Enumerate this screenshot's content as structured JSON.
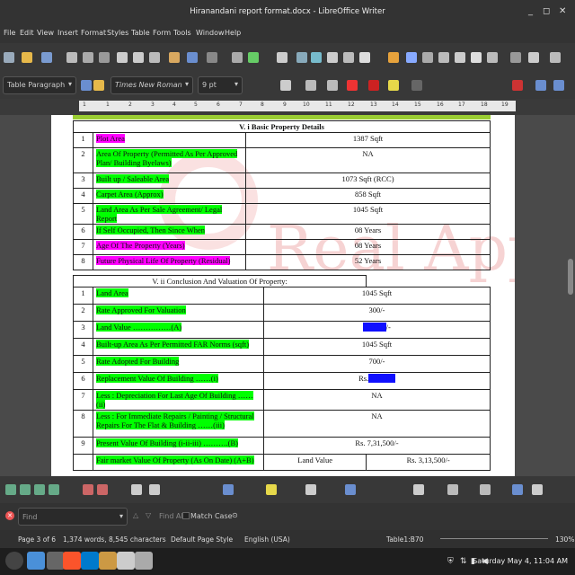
{
  "window": {
    "title": "Hiranandani report format.docx - LibreOffice Writer"
  },
  "menu": [
    "File",
    "Edit",
    "View",
    "Insert",
    "Format",
    "Styles",
    "Table",
    "Form",
    "Tools",
    "Window",
    "Help"
  ],
  "format": {
    "paragraph_style": "Table Paragraph",
    "font_name": "Times New Roman",
    "font_size": "9 pt"
  },
  "ruler": [
    "1",
    "1",
    "2",
    "3",
    "4",
    "5",
    "6",
    "7",
    "8",
    "9",
    "10",
    "11",
    "12",
    "13",
    "14",
    "15",
    "16",
    "17",
    "18",
    "19"
  ],
  "watermark": "Real Apple",
  "section1": {
    "title": "V. i Basic Property Details",
    "rows": [
      {
        "n": "1",
        "label": "Plot Area",
        "value": "1387 Sqft",
        "hl": "m"
      },
      {
        "n": "2",
        "label": "Area Of Property (Permitted As Per Approved Plan/ Building Byelaws)",
        "value": "NA",
        "hl": "g"
      },
      {
        "n": "3",
        "label": "Built up / Saleable Area",
        "value": "1073 Sqft (RCC)",
        "hl": "g"
      },
      {
        "n": "4",
        "label": "Carpet Area (Approx)",
        "value": "858 Sqft",
        "hl": "g"
      },
      {
        "n": "5",
        "label": "Land Area As Per Sale Agreement/ Legal Report",
        "value": "1045 Sqft",
        "hl": "g"
      },
      {
        "n": "6",
        "label": "If Self Occupied, Then Since When",
        "value": "08 Years",
        "hl": "g"
      },
      {
        "n": "7",
        "label": "Age Of The Property (Years)",
        "value": "08 Years",
        "hl": "m"
      },
      {
        "n": "8",
        "label": "Future Physical Life Of Property (Residual)",
        "value": "52 Years",
        "hl": "m"
      }
    ]
  },
  "section2": {
    "title": "V. ii Conclusion And Valuation Of Property:",
    "rows": [
      {
        "n": "1",
        "label": "Land Area",
        "value": "1045 Sqft"
      },
      {
        "n": "2",
        "label": "Rate Approved For Valuation",
        "value": "300/-"
      },
      {
        "n": "3",
        "label": "Land Value ……………(A)",
        "value": "/-"
      },
      {
        "n": "4",
        "label": "Built-up Area As Per Permitted FAR Norms (sqft)",
        "value": "1045 Sqft"
      },
      {
        "n": "5",
        "label": "Rate Adopted For Building",
        "value": "700/-"
      },
      {
        "n": "6",
        "label": "Replacement Value Of Building ……(i)",
        "value": "Rs."
      },
      {
        "n": "7",
        "label": "Less : Depreciation For Last Age Of Building ……(ii)",
        "value": "NA"
      },
      {
        "n": "8",
        "label": "Less : For Immediate Repairs / Painting / Structural Repairs For The Flat & Building ……(iii)",
        "value": "NA"
      },
      {
        "n": "9",
        "label": "Present Value Of Building (i-ii-iii) ……….(B)",
        "value": "Rs.   7,31,500/-"
      }
    ],
    "fmv": {
      "label": "Fair market Value Of Property (As On Date) (A+B)",
      "sub": "Land Value",
      "value": "Rs.  3,13,500/-"
    }
  },
  "find": {
    "placeholder": "Find",
    "find_all": "Find All",
    "match_case": "Match Case"
  },
  "status": {
    "page": "Page 3 of 6",
    "words": "1,374 words, 8,545 characters",
    "page_style": "Default Page Style",
    "language": "English (USA)",
    "table": "Table1:B70",
    "zoom": "130%"
  },
  "clock": "Saturday May 4, 11:04 AM"
}
